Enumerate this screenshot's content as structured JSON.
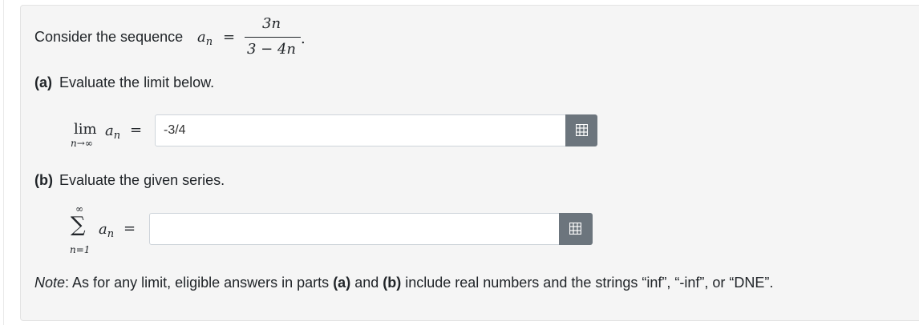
{
  "intro": {
    "text": "Consider the sequence",
    "var": "a",
    "sub": "n",
    "eq": "=",
    "numerator": "3n",
    "denominator": "3 − 4n",
    "period": "."
  },
  "part_a": {
    "label": "(a)",
    "text": "Evaluate the limit below.",
    "lim": "lim",
    "lim_sub": "n→∞",
    "var": "a",
    "sub": "n",
    "eq": "=",
    "input_value": "-3/4",
    "button_icon": "grid-icon"
  },
  "part_b": {
    "label": "(b)",
    "text": "Evaluate the given series.",
    "sigma": "∑",
    "sigma_top": "∞",
    "sigma_bottom": "n=1",
    "var": "a",
    "sub": "n",
    "eq": "=",
    "input_value": "",
    "button_icon": "grid-icon"
  },
  "note": {
    "label": "Note",
    "colon": ":",
    "text1": " As for any limit, eligible answers in parts ",
    "a": "(a)",
    "and": " and ",
    "b": "(b)",
    "text2": " include real numbers and the strings “inf”, “-inf”, or “DNE”."
  },
  "colors": {
    "panel_bg": "#f5f5f5",
    "button_bg": "#6c757d",
    "text": "#212529"
  }
}
